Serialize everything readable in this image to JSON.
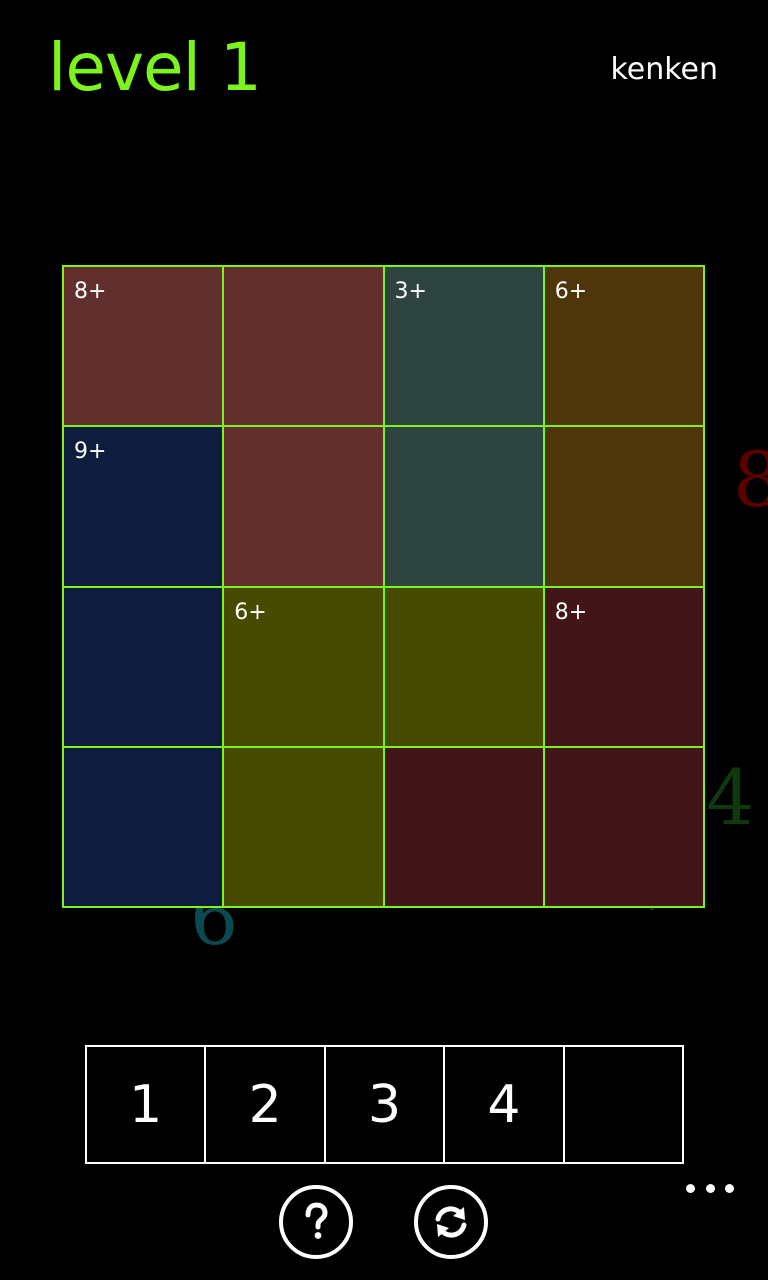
{
  "header": {
    "title": "level 1",
    "app_name": "kenken"
  },
  "colors": {
    "accent": "#7cf31c",
    "cage_a": "#622f2f",
    "cage_b": "#2e4440",
    "cage_c": "#4e350a",
    "cage_d": "#0e1c3e",
    "cage_e": "#464b00",
    "cage_f": "#421518"
  },
  "background_digits": [
    "8",
    "4",
    "6"
  ],
  "board": {
    "size": 4,
    "cells": [
      {
        "clue": "8+",
        "color": "#622f2f",
        "value": ""
      },
      {
        "clue": "",
        "color": "#622f2f",
        "value": ""
      },
      {
        "clue": "3+",
        "color": "#2e4440",
        "value": ""
      },
      {
        "clue": "6+",
        "color": "#4e350a",
        "value": ""
      },
      {
        "clue": "9+",
        "color": "#0e1c3e",
        "value": ""
      },
      {
        "clue": "",
        "color": "#622f2f",
        "value": ""
      },
      {
        "clue": "",
        "color": "#2e4440",
        "value": ""
      },
      {
        "clue": "",
        "color": "#4e350a",
        "value": ""
      },
      {
        "clue": "",
        "color": "#0e1c3e",
        "value": ""
      },
      {
        "clue": "6+",
        "color": "#464b00",
        "value": ""
      },
      {
        "clue": "",
        "color": "#464b00",
        "value": ""
      },
      {
        "clue": "8+",
        "color": "#421518",
        "value": ""
      },
      {
        "clue": "",
        "color": "#0e1c3e",
        "value": ""
      },
      {
        "clue": "",
        "color": "#464b00",
        "value": ""
      },
      {
        "clue": "",
        "color": "#421518",
        "value": ""
      },
      {
        "clue": "",
        "color": "#421518",
        "value": ""
      }
    ]
  },
  "palette": {
    "keys": [
      "1",
      "2",
      "3",
      "4",
      ""
    ]
  },
  "app_bar": {
    "help_icon": "question-icon",
    "refresh_icon": "refresh-icon",
    "more_icon": "ellipsis-icon"
  }
}
